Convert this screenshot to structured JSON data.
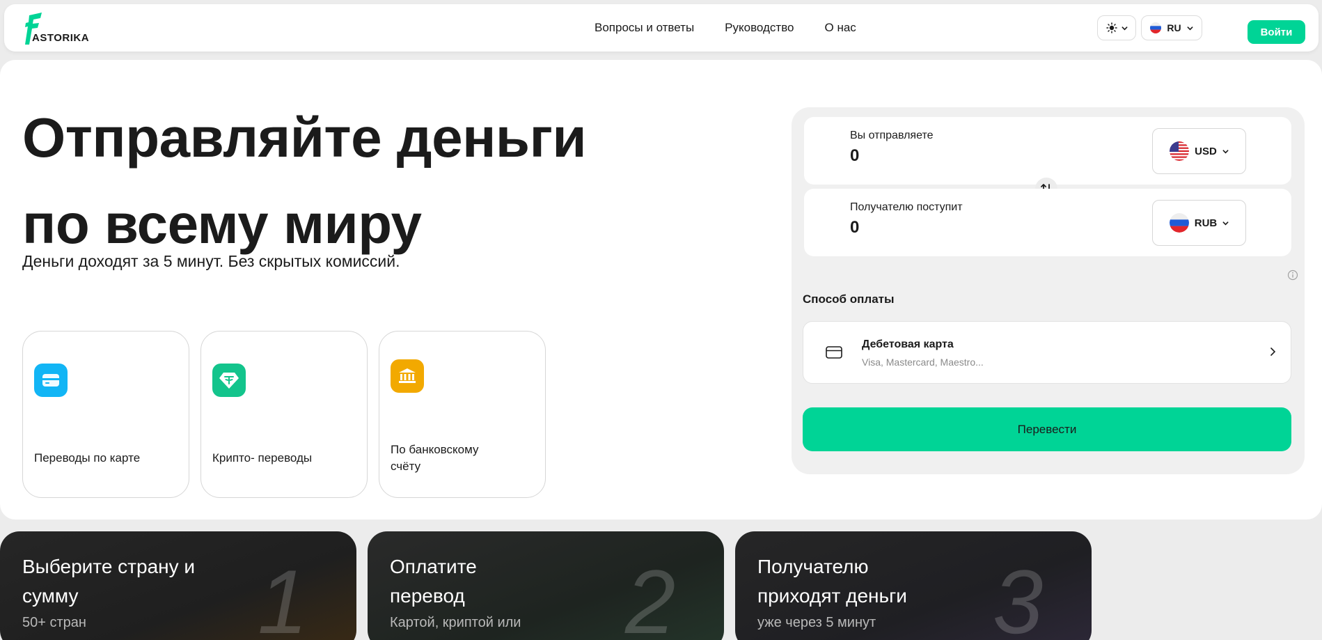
{
  "header": {
    "logo_text": "ASTORIKA",
    "nav": [
      "Вопросы и ответы",
      "Руководство",
      "О нас"
    ],
    "lang": "RU",
    "login": "Войти"
  },
  "hero": {
    "title_line1": "Отправляйте деньги",
    "title_line2": "по всему миру",
    "subtitle": "Деньги доходят за 5 минут. Без скрытых комиссий.",
    "services": [
      {
        "label": "Переводы по карте",
        "icon": "credit-card-icon",
        "color": "#12b5f5"
      },
      {
        "label": "Крипто- переводы",
        "icon": "tether-icon",
        "color": "#13c48c"
      },
      {
        "label": "По банковскому счёту",
        "icon": "bank-icon",
        "color": "#f2a900"
      }
    ]
  },
  "calculator": {
    "send_label": "Вы отправляете",
    "send_value": "0",
    "send_currency": "USD",
    "receive_label": "Получателю поступит",
    "receive_value": "0",
    "receive_currency": "RUB",
    "payment_title": "Способ оплаты",
    "payment_method": "Дебетовая карта",
    "payment_sub": "Visa, Mastercard, Maestro...",
    "submit": "Перевести"
  },
  "steps": [
    {
      "title": "Выберите страну и сумму",
      "sub": "50+ стран",
      "num": "1"
    },
    {
      "title": "Оплатите перевод",
      "sub": "Картой, криптой или",
      "num": "2"
    },
    {
      "title": "Получателю приходят деньги",
      "sub": "уже через 5 минут",
      "num": "3"
    }
  ],
  "colors": {
    "accent": "#00d496"
  }
}
